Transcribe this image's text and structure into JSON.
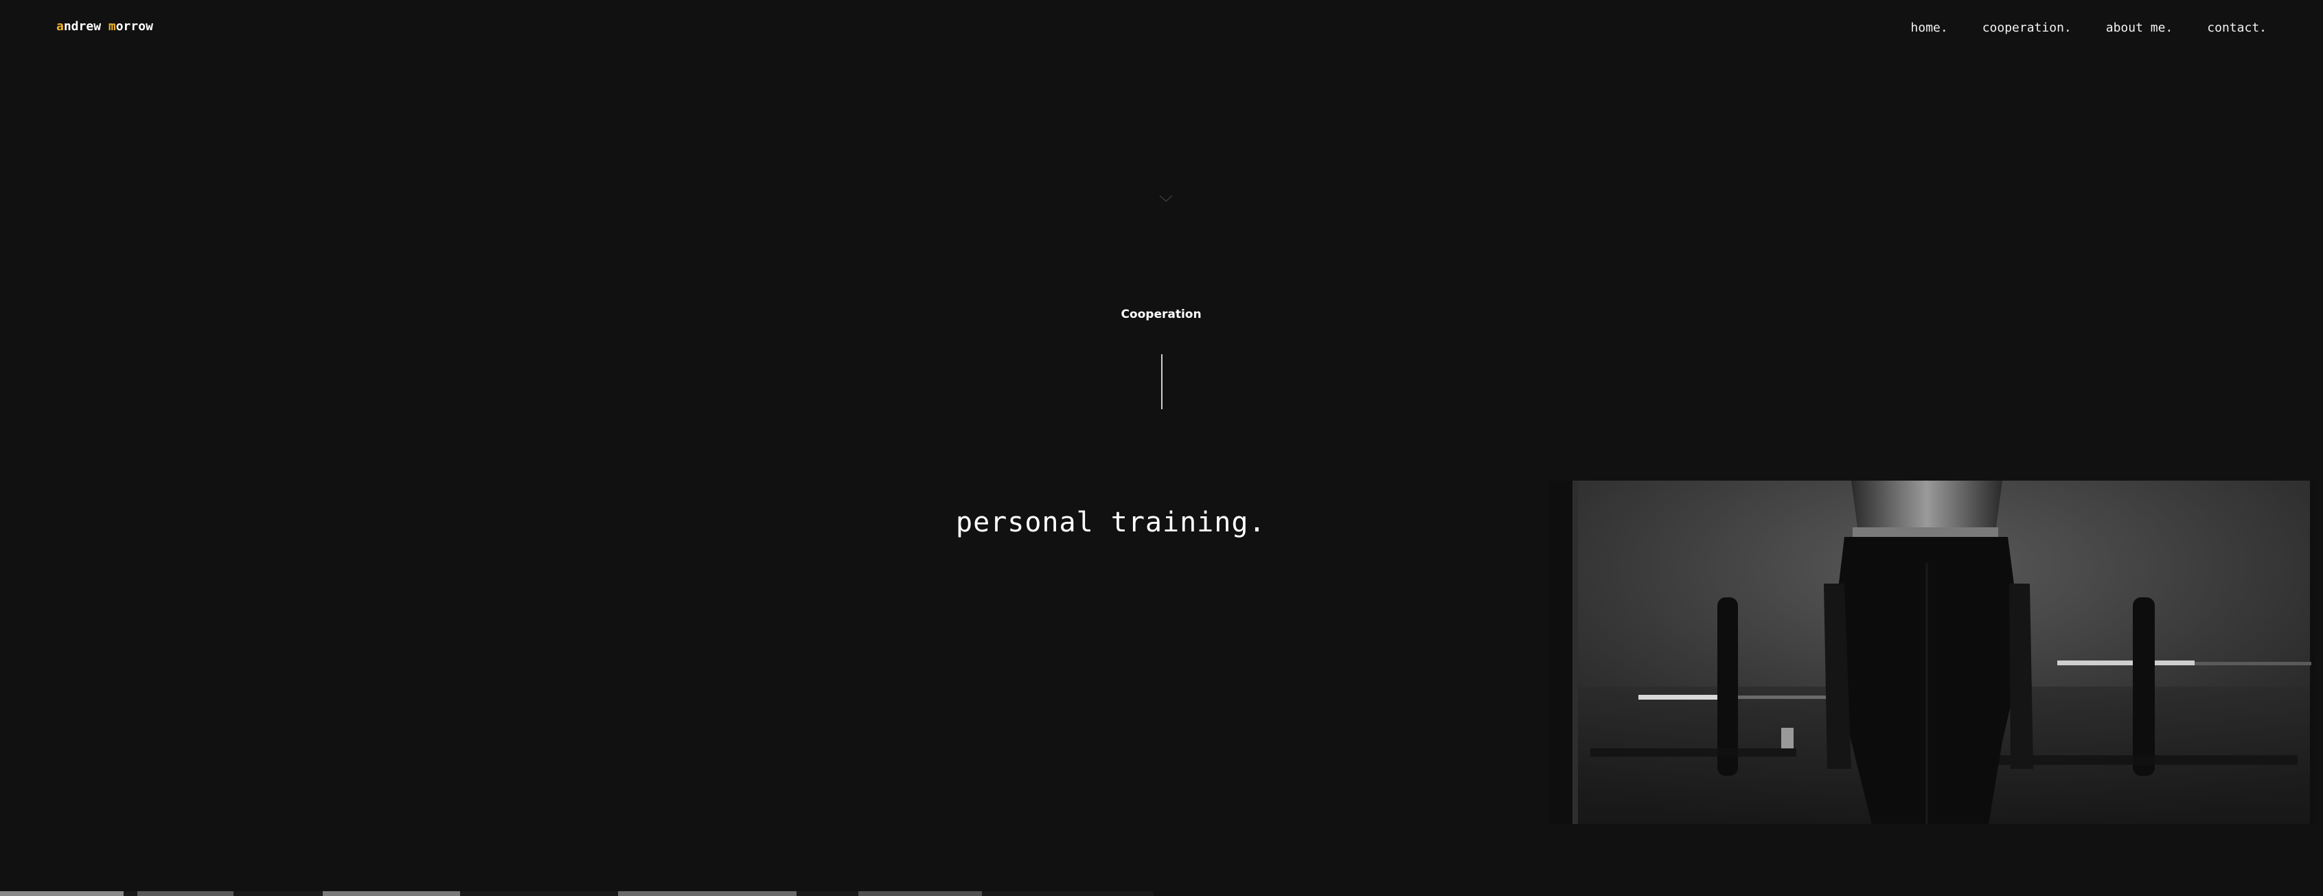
{
  "header": {
    "logo": {
      "first_initial": "a",
      "first_rest": "ndrew ",
      "last_initial": "m",
      "last_rest": "orrow",
      "accent_color": "#f0b429"
    },
    "nav": [
      {
        "label": "home."
      },
      {
        "label": "cooperation."
      },
      {
        "label": "about me."
      },
      {
        "label": "contact."
      }
    ]
  },
  "main": {
    "scroll_icon": "chevron-down-icon",
    "section_label": "Cooperation",
    "service_title": "personal training.",
    "image_subject": "gym barbell photo"
  },
  "colors": {
    "background": "#111111",
    "text": "#ffffff",
    "accent": "#f0b429"
  }
}
